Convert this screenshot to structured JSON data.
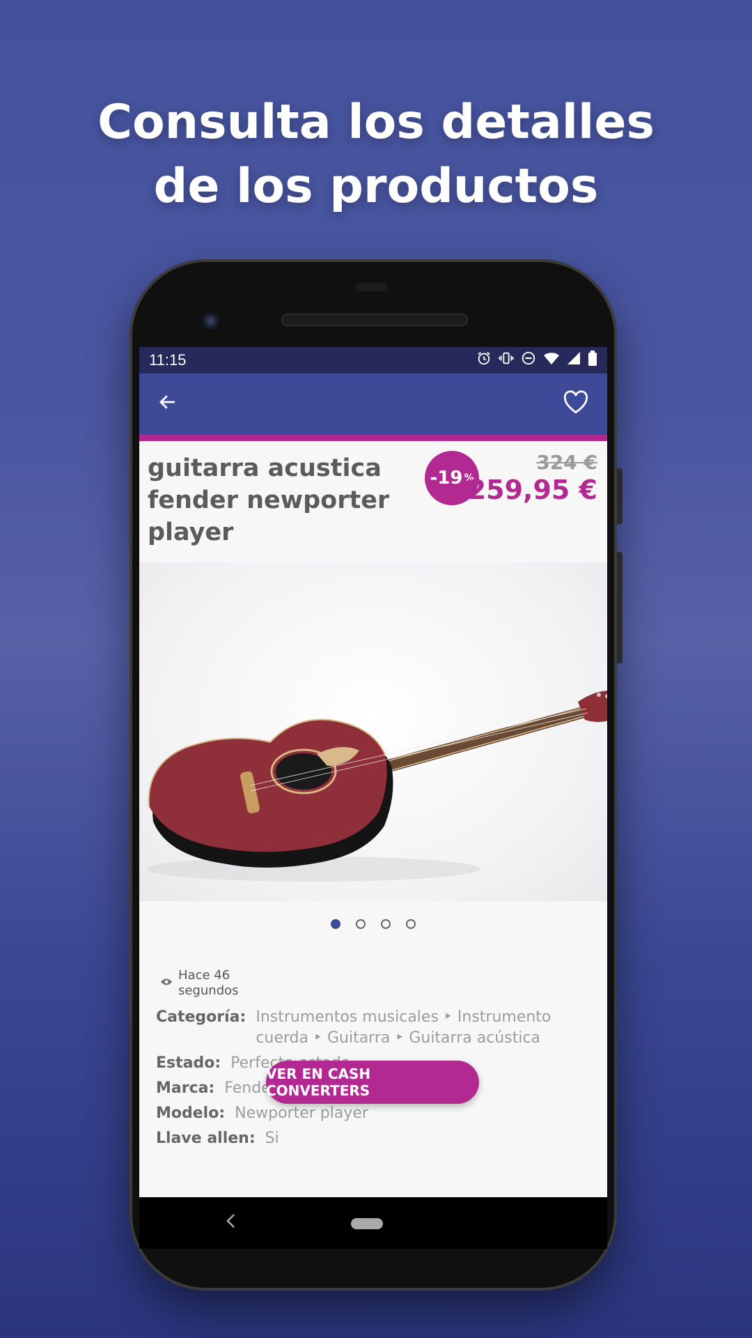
{
  "headline": {
    "line1": "Consulta los detalles",
    "line2": "de los productos"
  },
  "status_bar": {
    "time": "11:15",
    "icons": [
      "alarm-icon",
      "vibrate-icon",
      "dnd-icon",
      "wifi-icon",
      "signal-icon",
      "battery-icon"
    ]
  },
  "app_bar": {
    "back_icon": "arrow-left-icon",
    "favorite_icon": "heart-outline-icon"
  },
  "product": {
    "title": "guitarra acustica fender newporter player",
    "discount_number": "-19",
    "discount_unit": "%",
    "old_price": "324 €",
    "new_price": "259,95 €",
    "image": "acoustic-guitar",
    "gallery": {
      "count": 4,
      "active": 0
    },
    "views_text": "Hace 46",
    "views_text2": "segundos",
    "specs": [
      {
        "key": "Categoría:",
        "value": "Instrumentos musicales ‣ Instrumento cuerda ‣ Guitarra ‣ Guitarra acústica"
      },
      {
        "key": "Estado:",
        "value": "Perfecto estado"
      },
      {
        "key": "Marca:",
        "value": "Fender"
      },
      {
        "key": "Modelo:",
        "value": "Newporter player"
      },
      {
        "key": "Llave allen:",
        "value": "Si"
      }
    ],
    "cta_label": "VER EN CASH CONVERTERS"
  },
  "colors": {
    "accent": "#b22a91",
    "primary": "#3e4a98",
    "status_bar": "#252a5a"
  }
}
